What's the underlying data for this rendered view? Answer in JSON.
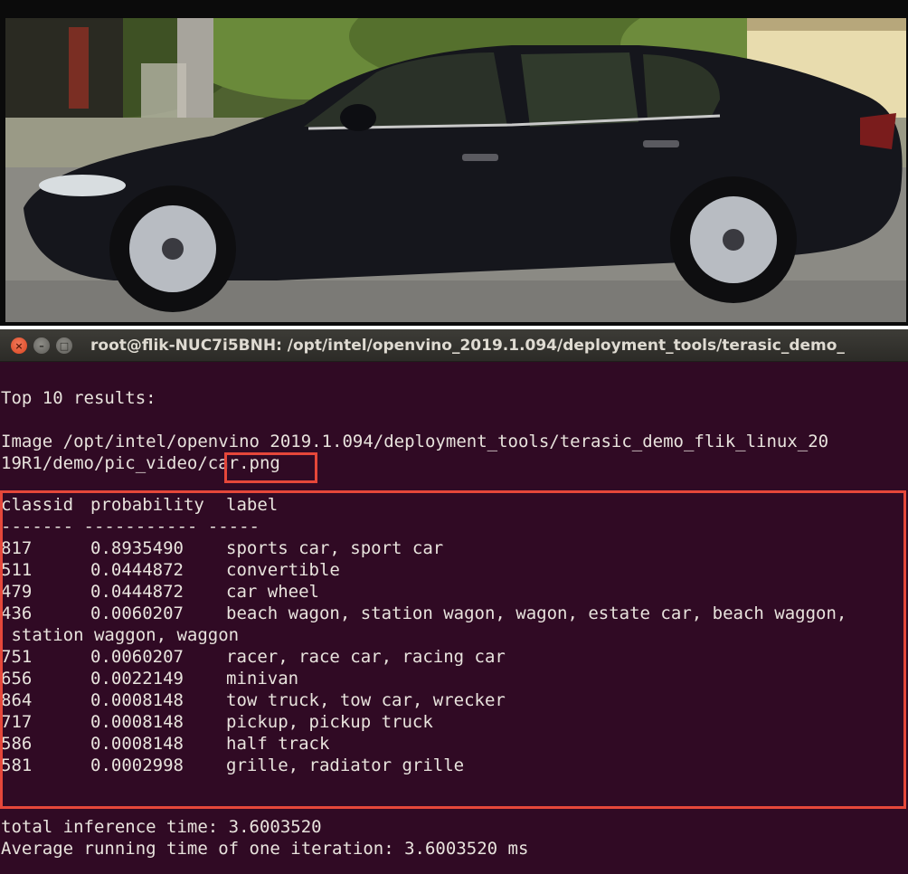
{
  "terminal": {
    "title": "root@flik-NUC7i5BNH: /opt/intel/openvino_2019.1.094/deployment_tools/terasic_demo_",
    "header_line": "Top 10 results:",
    "image_line_1": "Image /opt/intel/openvino 2019.1.094/deployment_tools/terasic_demo_flik_linux_20",
    "image_line_2_prefix": "19R1/demo/pic_video/",
    "image_file": "car.png",
    "table": {
      "headers": {
        "classid": "classid",
        "probability": "probability",
        "label": "label"
      },
      "separator": "------- ----------- -----",
      "rows": [
        {
          "classid": "817",
          "probability": "0.8935490",
          "label": "sports car, sport car"
        },
        {
          "classid": "511",
          "probability": "0.0444872",
          "label": "convertible"
        },
        {
          "classid": "479",
          "probability": "0.0444872",
          "label": "car wheel"
        },
        {
          "classid": "436",
          "probability": "0.0060207",
          "label": "beach wagon, station wagon, wagon, estate car, beach waggon,",
          "label_cont": " station waggon, waggon"
        },
        {
          "classid": "751",
          "probability": "0.0060207",
          "label": "racer, race car, racing car"
        },
        {
          "classid": "656",
          "probability": "0.0022149",
          "label": "minivan"
        },
        {
          "classid": "864",
          "probability": "0.0008148",
          "label": "tow truck, tow car, wrecker"
        },
        {
          "classid": "717",
          "probability": "0.0008148",
          "label": "pickup, pickup truck"
        },
        {
          "classid": "586",
          "probability": "0.0008148",
          "label": "half track"
        },
        {
          "classid": "581",
          "probability": "0.0002998",
          "label": "grille, radiator grille"
        }
      ]
    },
    "total_time_line": "total inference time: 3.6003520",
    "avg_time_line": "Average running time of one iteration: 3.6003520 ms",
    "window_buttons": {
      "close": "×",
      "minimize": "–",
      "maximize": "□"
    }
  },
  "colors": {
    "terminal_bg": "#300a24",
    "terminal_text": "#e8e3dd",
    "highlight": "#e5473a",
    "titlebar": "#3d3c37"
  }
}
